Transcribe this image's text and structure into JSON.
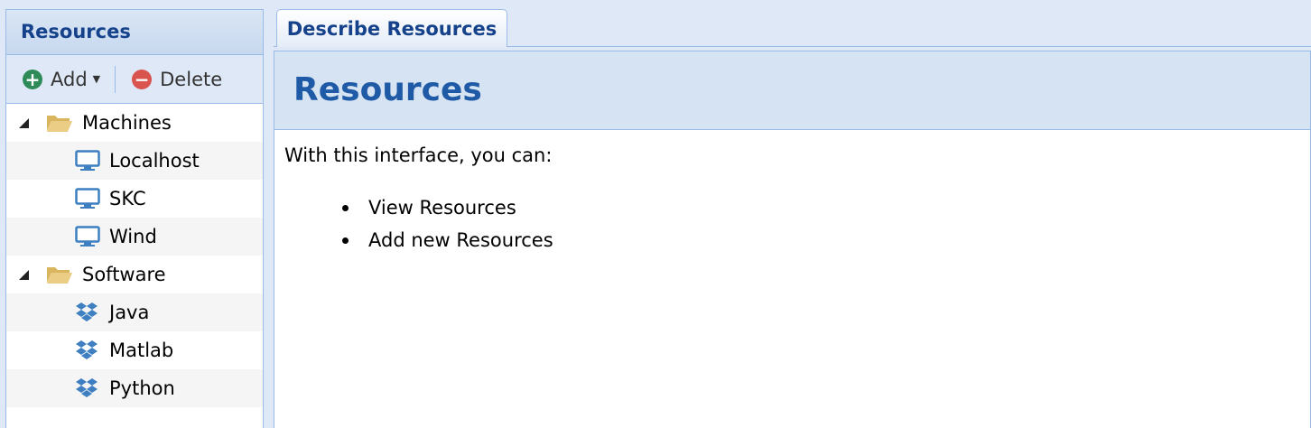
{
  "sidebar": {
    "title": "Resources",
    "toolbar": {
      "add_label": "Add",
      "delete_label": "Delete"
    },
    "tree": {
      "machines": {
        "label": "Machines",
        "children": [
          "Localhost",
          "SKC",
          "Wind"
        ]
      },
      "software": {
        "label": "Software",
        "children": [
          "Java",
          "Matlab",
          "Python"
        ]
      }
    }
  },
  "tab": {
    "label": "Describe Resources"
  },
  "main": {
    "title": "Resources",
    "intro": "With this interface, you can:",
    "bullets": [
      "View Resources",
      "Add new Resources"
    ]
  },
  "colors": {
    "panel_title": "#15428b",
    "main_title": "#1f5aa6",
    "border": "#99bbe8",
    "add_icon": "#2e8b57",
    "delete_icon": "#d9534f",
    "folder": "#e8c77a",
    "machine_icon": "#3d7fc1",
    "software_icon": "#3d7fc1"
  },
  "icons": {
    "add": "plus-circle-icon",
    "delete": "minus-circle-icon",
    "folder": "folder-open-icon",
    "machine": "monitor-icon",
    "software": "dropbox-icon",
    "expander": "triangle-expanded-icon"
  }
}
